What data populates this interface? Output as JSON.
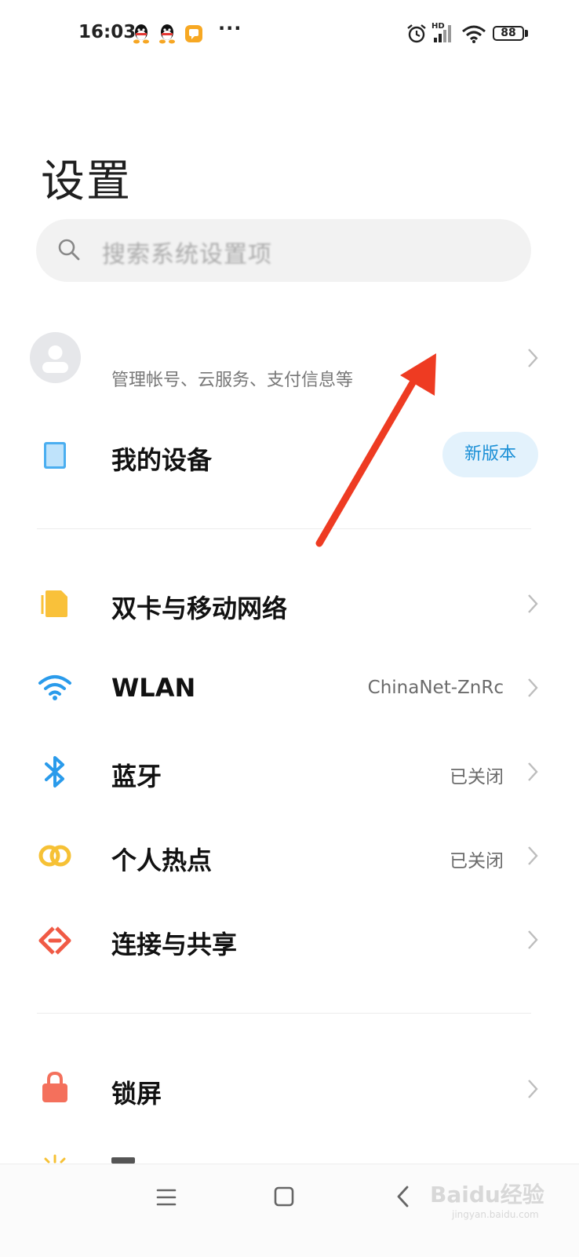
{
  "status_bar": {
    "time": "16:03",
    "more": "···",
    "battery": "88",
    "network_label": "HD",
    "icons": [
      "qq-icon",
      "qq-icon",
      "message-app-icon",
      "alarm-icon",
      "signal-icon",
      "wifi-icon",
      "battery-icon"
    ]
  },
  "page": {
    "title": "设置"
  },
  "search": {
    "placeholder": "搜索系统设置项"
  },
  "account": {
    "subtitle": "管理帐号、云服务、支付信息等"
  },
  "my_device": {
    "label": "我的设备",
    "badge": "新版本"
  },
  "network_items": [
    {
      "label": "双卡与移动网络",
      "value": "",
      "icon": "sim-card-icon",
      "color": "#F9C13A"
    },
    {
      "label": "WLAN",
      "value": "ChinaNet-ZnRc",
      "icon": "wifi-icon",
      "color": "#2A9BEB"
    },
    {
      "label": "蓝牙",
      "value": "已关闭",
      "icon": "bluetooth-icon",
      "color": "#2A9BEB"
    },
    {
      "label": "个人热点",
      "value": "已关闭",
      "icon": "hotspot-icon",
      "color": "#F6C135"
    },
    {
      "label": "连接与共享",
      "value": "",
      "icon": "share-icon",
      "color": "#F05A45"
    }
  ],
  "lock_item": {
    "label": "锁屏",
    "icon": "lock-icon",
    "color": "#F4705C"
  },
  "nav": {
    "menu": "menu-icon",
    "home": "home-icon",
    "back": "back-icon"
  },
  "watermark": {
    "brand": "Baidu经验",
    "url": "jingyan.baidu.com"
  },
  "annotation": {
    "color": "#EE3B22"
  }
}
